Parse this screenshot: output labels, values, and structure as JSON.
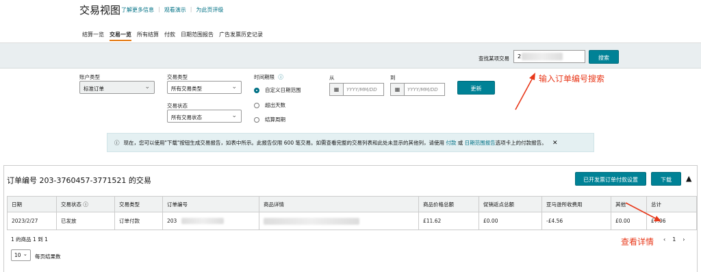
{
  "header": {
    "title": "交易视图",
    "links": [
      "了解更多信息",
      "观看演示",
      "为此页评级"
    ]
  },
  "tabs": [
    "结算一览",
    "交易一览",
    "所有结算",
    "付款",
    "日期范围报告",
    "广告发票历史记录"
  ],
  "active_tab": "交易一览",
  "search": {
    "label": "查找某项交易",
    "value": "2",
    "button": "搜索"
  },
  "filters": {
    "account_type_label": "账户类型",
    "account_type_value": "标准订单",
    "txn_type_label": "交易类型",
    "txn_type_value": "所有交易类型",
    "txn_status_label": "交易状态",
    "txn_status_value": "所有交易状态",
    "time_label": "时间期限",
    "time_info_icon": "info-icon",
    "radio_options": [
      "自定义日期范围",
      "超出天数",
      "结算周期"
    ],
    "from_label": "从",
    "to_label": "到",
    "date_placeholder": "YYYY/MM/DD",
    "update_button": "更新"
  },
  "annotations": {
    "search_hint": "输入订单编号搜索",
    "detail_hint": "查看详情"
  },
  "info": {
    "text_before": "现在，您可以使用\"下载\"按钮生成交易报告，如表中所示。此报告仅限 600 笔交易。如需查看完整的交易列表和此处未显示的其他列，请使用",
    "link1": "付款",
    "mid": "或",
    "link2": "日期范围报告",
    "text_after": "选项卡上的付款报告。"
  },
  "panel": {
    "title": "订单编号 203-3760457-3771521 的交易",
    "settings_button": "已开发票订单付款设置",
    "download_button": "下载"
  },
  "table": {
    "headers": [
      "日期",
      "交易状态",
      "交易类型",
      "订单编号",
      "商品详情",
      "商品价格总额",
      "促销返点总额",
      "亚马逊所收费用",
      "其他",
      "总计"
    ],
    "row": {
      "date": "2023/2/27",
      "status": "已发放",
      "type": "订单付款",
      "order": "203",
      "product": "",
      "price": "£11.62",
      "promo": "£0.00",
      "fees": "-£4.56",
      "other": "£0.00",
      "total": "£7.06"
    }
  },
  "footer": {
    "count_text": "1 的商品 1 到 1",
    "page": "1",
    "per_page": "10",
    "per_page_label": "每页结果数"
  },
  "colors": {
    "accent": "#008296",
    "link": "#007185",
    "annotation": "#e8381a",
    "negative": "#cc3b10"
  }
}
